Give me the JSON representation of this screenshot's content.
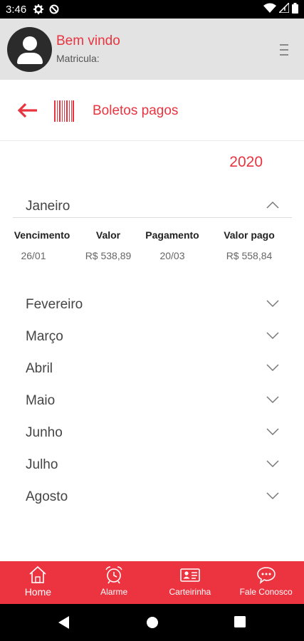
{
  "status_bar": {
    "time": "3:46",
    "left_icons": [
      "gear-icon",
      "sync-off-icon"
    ],
    "right_icons": [
      "wifi-icon",
      "signal-icon",
      "battery-icon"
    ]
  },
  "header": {
    "welcome": "Bem vindo",
    "matricula_label": "Matricula:"
  },
  "title_bar": {
    "title": "Boletos pagos"
  },
  "year": "2020",
  "expanded_month": {
    "name": "Janeiro",
    "columns": [
      "Vencimento",
      "Valor",
      "Pagamento",
      "Valor pago"
    ],
    "rows": [
      [
        "26/01",
        "R$ 538,89",
        "20/03",
        "R$ 558,84"
      ]
    ]
  },
  "months": [
    "Fevereiro",
    "Março",
    "Abril",
    "Maio",
    "Junho",
    "Julho",
    "Agosto"
  ],
  "bottom_nav": [
    {
      "label": "Home",
      "icon": "home-icon"
    },
    {
      "label": "Alarme",
      "icon": "alarm-clock-icon"
    },
    {
      "label": "Carteirinha",
      "icon": "id-card-icon"
    },
    {
      "label": "Fale Conosco",
      "icon": "chat-bubble-icon"
    }
  ],
  "colors": {
    "accent": "#e8343f",
    "bottom_nav_bg": "#ec3340",
    "header_bg": "#e3e3e3"
  }
}
